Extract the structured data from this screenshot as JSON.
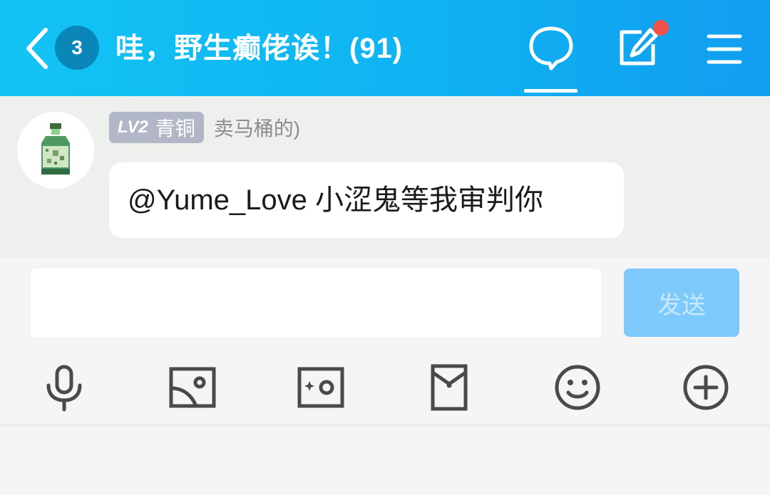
{
  "header": {
    "unread_count": "3",
    "title": "哇，野生癫佬诶！(91)",
    "has_notification": true
  },
  "message": {
    "level_tag": "LV2",
    "level_name": "青铜",
    "nickname": "卖马桶的)",
    "text": "@Yume_Love 小涩鬼等我审判你"
  },
  "composer": {
    "input_value": "",
    "send_label": "发送"
  },
  "toolbar": {
    "icons": [
      "microphone-icon",
      "image-icon",
      "camera-icon",
      "red-packet-icon",
      "emoji-icon",
      "plus-icon"
    ]
  },
  "colors": {
    "header_start": "#12c4f4",
    "header_end": "#129df0",
    "send_button": "#7ec9fb",
    "notification_dot": "#f2524a",
    "icon_gray": "#4a4a4a"
  }
}
